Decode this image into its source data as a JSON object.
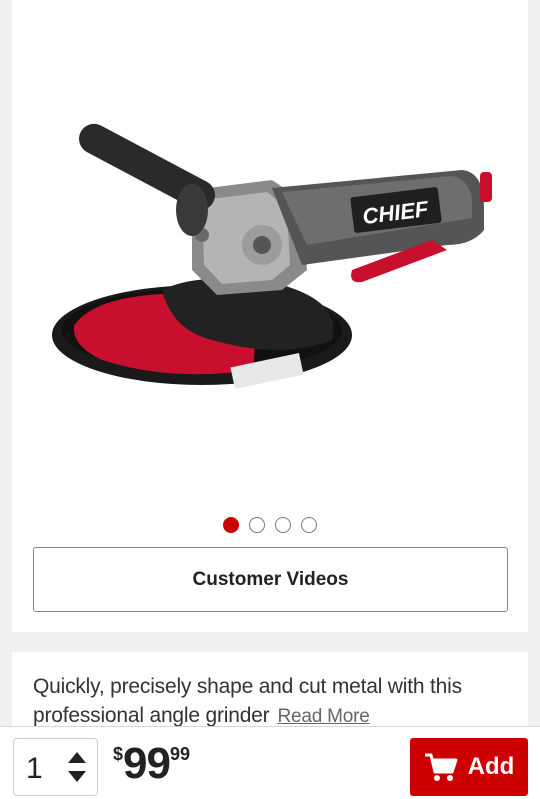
{
  "product": {
    "image_alt": "Chief angle grinder",
    "brand_logo": "CHIEF",
    "carousel": {
      "total": 4,
      "active": 1
    }
  },
  "videos_button": {
    "label": "Customer Videos"
  },
  "description": {
    "text": "Quickly, precisely shape and cut metal with this professional angle grinder",
    "read_more": "Read More"
  },
  "purchase": {
    "quantity": "1",
    "price_currency": "$",
    "price_dollars": "99",
    "price_cents": "99",
    "add_label": "Add",
    "accent_color": "#cc0000"
  },
  "icons": [
    "cart-icon",
    "stepper-arrows-icon"
  ]
}
